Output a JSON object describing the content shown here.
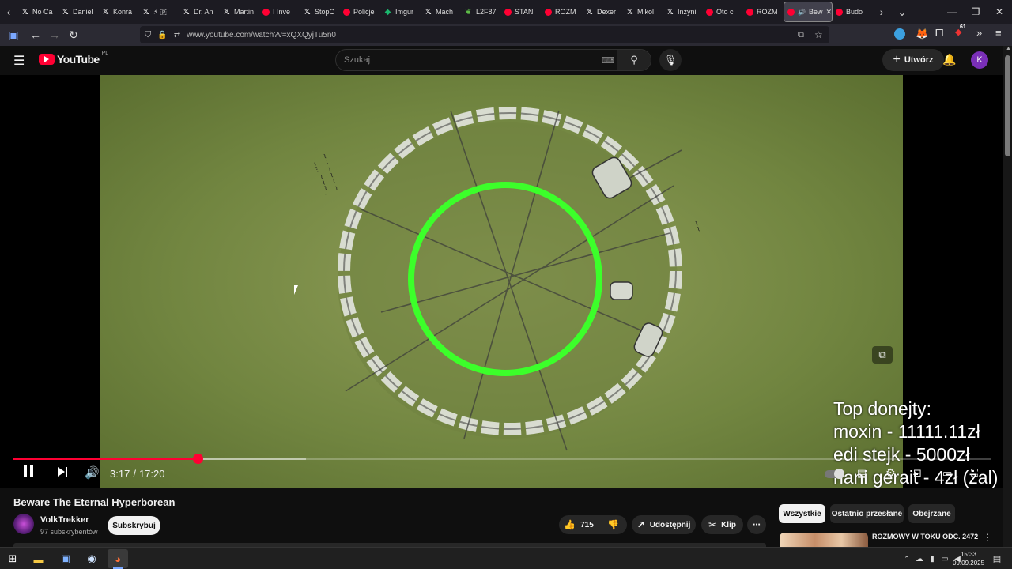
{
  "browser": {
    "tabs": [
      {
        "label": "No Ca",
        "icon": "x-logo-icon"
      },
      {
        "label": "Daniel",
        "icon": "x-logo-icon"
      },
      {
        "label": "Konra",
        "icon": "x-logo-icon"
      },
      {
        "label": "⚡ 🇵",
        "icon": "x-logo-icon"
      },
      {
        "label": "Dr. An",
        "icon": "x-logo-icon"
      },
      {
        "label": "Martin",
        "icon": "x-logo-icon"
      },
      {
        "label": "I Inve",
        "icon": "youtube-icon"
      },
      {
        "label": "StopC",
        "icon": "x-logo-icon"
      },
      {
        "label": "Policje",
        "icon": "youtube-icon"
      },
      {
        "label": "Imgur",
        "icon": "imgur-icon"
      },
      {
        "label": "Mach",
        "icon": "x-logo-icon"
      },
      {
        "label": "L2F87",
        "icon": "leaf-icon"
      },
      {
        "label": "STAN",
        "icon": "youtube-icon"
      },
      {
        "label": "ROZM",
        "icon": "youtube-icon"
      },
      {
        "label": "Dexer",
        "icon": "x-logo-icon"
      },
      {
        "label": "Mikol",
        "icon": "x-logo-icon"
      },
      {
        "label": "Inżyni",
        "icon": "x-logo-icon"
      },
      {
        "label": "Oto c",
        "icon": "youtube-icon"
      },
      {
        "label": "ROZM",
        "icon": "youtube-icon"
      },
      {
        "label": "Bew",
        "icon": "youtube-icon",
        "active": true
      },
      {
        "label": "Budo",
        "icon": "youtube-icon"
      }
    ],
    "url": "www.youtube.com/watch?v=xQXQyjTu5n0",
    "extension_badge": "61"
  },
  "youtube": {
    "logo_text": "YouTube",
    "region": "PL",
    "search_placeholder": "Szukaj",
    "create_label": "Utwórz",
    "avatar_letter": "K"
  },
  "player": {
    "current_time": "3:17",
    "duration": "17:20",
    "time_separator": "/",
    "progress_fraction": 0.1894,
    "buffered_fraction": 0.3,
    "overlay_lines": [
      "Top donejty:",
      "moxin - 11111.11zł",
      "edi stejk - 5000zł",
      "nani gerait - 4zł (żal)"
    ]
  },
  "video": {
    "title": "Beware The Eternal Hyperborean",
    "channel": "VolkTrekker",
    "subscribers": "97 subskrybentów",
    "subscribe_label": "Subskrybuj",
    "likes": "715",
    "share_label": "Udostępnij",
    "clip_label": "Klip"
  },
  "filters": [
    "Wszystkie",
    "Ostatnio przesłane",
    "Obejrzane"
  ],
  "recommended": [
    {
      "title": "ROZMOWY W TOKU ODC. 2472"
    }
  ],
  "colors": {
    "accent": "#ff0033",
    "green_circle": "#3cff2a",
    "avatar": "#7a2fb8"
  },
  "taskbar": {
    "time": "15:33",
    "date": "09.09.2025"
  }
}
